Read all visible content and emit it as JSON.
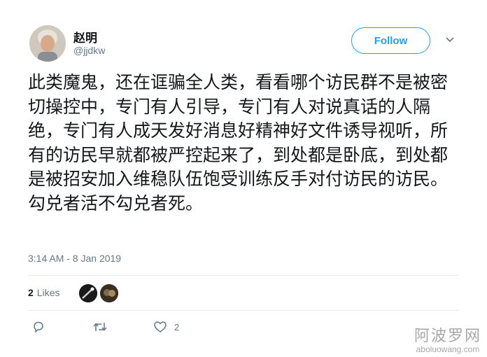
{
  "author": {
    "name": "赵明",
    "handle": "@jjdkw"
  },
  "follow_label": "Follow",
  "tweet": {
    "text": "此类魔鬼，还在诓骗全人类，看看哪个访民群不是被密切操控中，专门有人引导，专门有人对说真话的人隔绝，专门有人成天发好消息好精神好文件诱导视听，所有的访民早就都被严控起来了，到处都是卧底，到处都是被招安加入维稳队伍饱受训练反手对付访民的访民。勾兑者活不勾兑者死。",
    "timestamp": "3:14 AM - 8 Jan 2019"
  },
  "stats": {
    "likes_count": "2",
    "likes_label": "Likes"
  },
  "actions": {
    "like_count": "2"
  },
  "watermark": {
    "title": "阿波罗网",
    "url": "aboluowang.com"
  },
  "colors": {
    "accent": "#1da1f2",
    "muted": "#657786",
    "text": "#14171a"
  },
  "icons": [
    "chevron-down-icon",
    "reply-icon",
    "retweet-icon",
    "heart-icon"
  ]
}
